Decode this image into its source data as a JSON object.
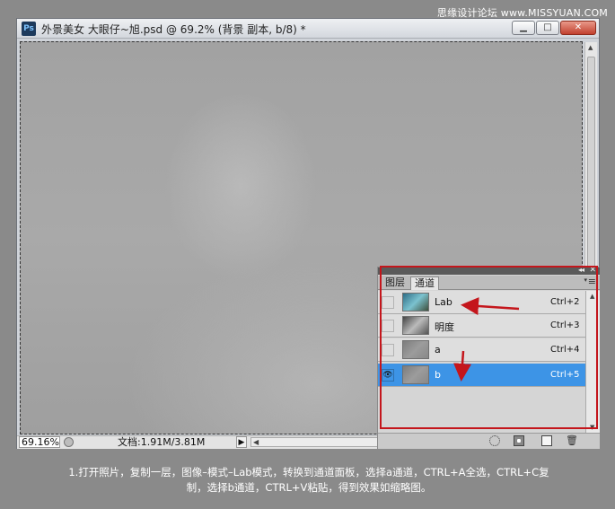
{
  "watermark": "思缘设计论坛 www.MISSYUAN.COM",
  "window": {
    "app_logo": "Ps",
    "title": "外景美女 大眼仔~旭.psd @ 69.2% (背景 副本, b/8) *",
    "buttons": {
      "minimize": "▁",
      "maximize": "□",
      "close": "✕"
    }
  },
  "statusbar": {
    "zoom": "69.16%",
    "doc_size": "文档:1.91M/3.81M",
    "menu_arrow": "▶",
    "scroll_left": "◀"
  },
  "panel": {
    "collapse": "◂◂",
    "close": "✕",
    "tabs": [
      {
        "label": "图层",
        "active": false
      },
      {
        "label": "通道",
        "active": true
      }
    ],
    "menu_arrow": "▾",
    "menu_icon": "≡",
    "channels": [
      {
        "name": "Lab",
        "shortcut": "Ctrl+2",
        "visible": false,
        "selected": false,
        "thumb": "lab"
      },
      {
        "name": "明度",
        "shortcut": "Ctrl+3",
        "visible": false,
        "selected": false,
        "thumb": "gray1"
      },
      {
        "name": "a",
        "shortcut": "Ctrl+4",
        "visible": false,
        "selected": false,
        "thumb": "gray2"
      },
      {
        "name": "b",
        "shortcut": "Ctrl+5",
        "visible": true,
        "selected": true,
        "thumb": "gray2"
      }
    ],
    "eye_glyph": "👁",
    "footer_icons": [
      "load-selection-icon",
      "save-selection-icon",
      "new-channel-icon",
      "trash-icon"
    ],
    "trash_glyph": "🗑"
  },
  "caption": {
    "line1": "1.打开照片，复制一层，图像–模式–Lab模式，转换到通道面板，选择a通道，CTRL+A全选，CTRL+C复",
    "line2": "制，选择b通道，CTRL+V粘贴，得到效果如缩略图。"
  },
  "colors": {
    "background": "#8a8a8a",
    "annotation_red": "#c4161c",
    "selected_row": "#3d94e6"
  }
}
